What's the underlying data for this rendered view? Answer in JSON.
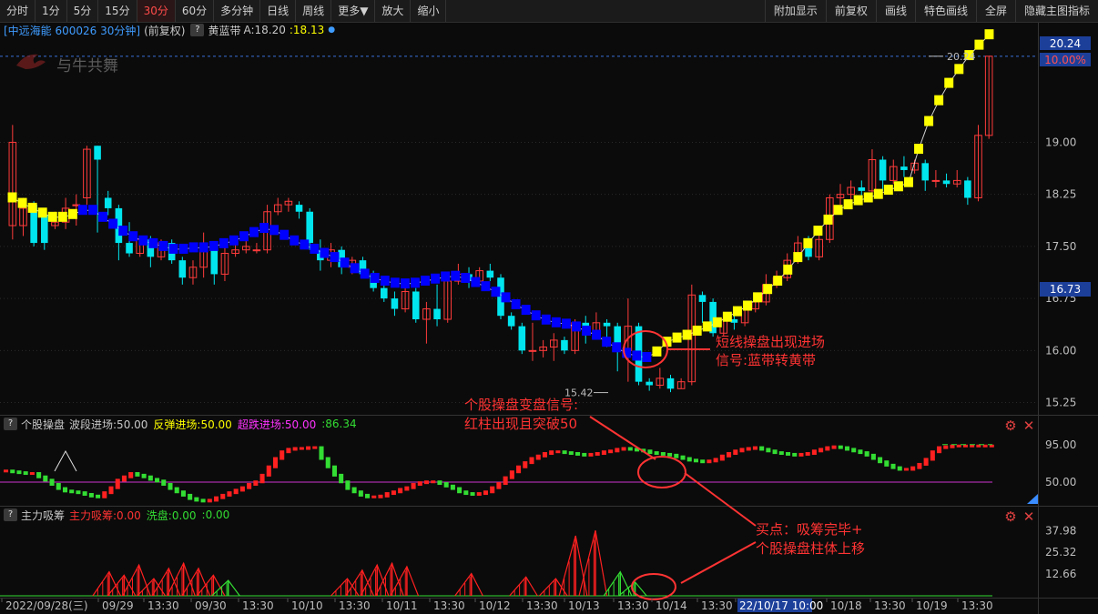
{
  "toolbar": {
    "left": [
      "分时",
      "1分",
      "5分",
      "15分",
      "30分",
      "60分",
      "多分钟",
      "日线",
      "周线",
      "更多▼",
      "放大",
      "缩小"
    ],
    "active": "30分",
    "right": [
      "附加显示",
      "前复权",
      "画线",
      "特色画线",
      "全屏",
      "隐藏主图指标"
    ]
  },
  "main_header": {
    "stock": "[中远海能 600026 30分钟]",
    "adjust": "(前复权)",
    "help": "?",
    "indicator_name": "黄蓝带",
    "a_label": "A:",
    "a_value": "18.20",
    "b_value": ":18.13",
    "watermark": "与牛共舞"
  },
  "price_axis": {
    "ticks": [
      "19.00",
      "18.25",
      "17.50",
      "16.75",
      "16.00",
      "15.25"
    ],
    "last_price": "20.24",
    "last_pct": "10.00%",
    "cursor_price": "16.73"
  },
  "annotations": {
    "high": "20.24",
    "low": "15.42",
    "main_note_1": "短线操盘出现进场",
    "main_note_2": "信号:蓝带转黄带",
    "mid_note_1": "个股操盘变盘信号:",
    "mid_note_2": "红柱出现且突破50",
    "bottom_note_1": "买点：吸筹完毕+",
    "bottom_note_2": "个股操盘柱体上移"
  },
  "panel2": {
    "help": "?",
    "name": "个股操盘",
    "l1": "波段进场:50.00",
    "l2": "反弹进场:50.00",
    "l3": "超跌进场:50.00",
    "l4": ":86.34",
    "ticks": [
      "95.00",
      "50.00"
    ],
    "gear": "gear-icon",
    "close": "close-icon"
  },
  "panel3": {
    "help": "?",
    "name": "主力吸筹",
    "l1": "主力吸筹:0.00",
    "l2": "洗盘:0.00",
    "l3": ":0.00",
    "ticks": [
      "37.98",
      "25.32",
      "12.66"
    ]
  },
  "time_axis": [
    "2022/09/28(三)",
    "09/29",
    "13:30",
    "09/30",
    "13:30",
    "10/10",
    "13:30",
    "10/11",
    "13:30",
    "10/12",
    "13:30",
    "10/13",
    "13:30",
    "10/14",
    "13:30",
    "22/10/17 10:00",
    "10/18",
    "13:30",
    "10/19",
    "13:30"
  ],
  "colors": {
    "up": "#ff3b3b",
    "down": "#00e5ee",
    "yellow_band": "#ffff00",
    "blue_band": "#0000ff",
    "osc_up": "#ff2020",
    "osc_down": "#33dd33",
    "accum_red": "#ff2020",
    "accum_green": "#33dd33",
    "ref_line": "#cc33cc",
    "annotation": "#ff3333"
  },
  "chart_data": [
    {
      "type": "candlestick",
      "title": "中远海能 600026 30分钟",
      "y_range": [
        15.1,
        20.5
      ],
      "y_ticks": [
        15.25,
        16.0,
        16.75,
        17.5,
        18.25,
        19.0
      ],
      "candles": [
        [
          17.8,
          19.0,
          19.25,
          17.6
        ],
        [
          17.8,
          18.05,
          18.2,
          17.65
        ],
        [
          18.1,
          17.55,
          18.15,
          17.5
        ],
        [
          17.95,
          17.55,
          18.05,
          17.45
        ],
        [
          17.8,
          17.85,
          18.0,
          17.75
        ],
        [
          17.85,
          18.05,
          18.2,
          17.75
        ],
        [
          18.1,
          18.1,
          18.25,
          17.8
        ],
        [
          18.2,
          18.9,
          18.95,
          18.1
        ],
        [
          18.95,
          18.75,
          18.95,
          17.7
        ],
        [
          18.2,
          18.05,
          18.3,
          17.95
        ],
        [
          18.05,
          17.55,
          18.1,
          17.3
        ],
        [
          17.55,
          17.4,
          17.85,
          17.35
        ],
        [
          17.4,
          17.6,
          17.65,
          17.35
        ],
        [
          17.6,
          17.35,
          17.65,
          17.2
        ],
        [
          17.35,
          17.55,
          17.6,
          17.3
        ],
        [
          17.55,
          17.3,
          17.6,
          17.25
        ],
        [
          17.3,
          17.05,
          17.35,
          16.95
        ],
        [
          17.05,
          17.2,
          17.3,
          16.95
        ],
        [
          17.2,
          17.55,
          17.7,
          17.05
        ],
        [
          17.5,
          17.1,
          17.55,
          16.95
        ],
        [
          17.1,
          17.4,
          17.5,
          17.0
        ],
        [
          17.4,
          17.45,
          17.6,
          17.35
        ],
        [
          17.45,
          17.5,
          17.65,
          17.4
        ],
        [
          17.45,
          17.45,
          17.55,
          17.4
        ],
        [
          17.45,
          18.0,
          18.1,
          17.4
        ],
        [
          18.0,
          18.1,
          18.2,
          17.95
        ],
        [
          18.1,
          18.15,
          18.2,
          18.0
        ],
        [
          18.1,
          18.0,
          18.15,
          17.9
        ],
        [
          18.0,
          17.55,
          18.05,
          17.45
        ],
        [
          17.45,
          17.3,
          17.6,
          17.15
        ],
        [
          17.3,
          17.45,
          17.55,
          17.2
        ],
        [
          17.45,
          17.2,
          17.5,
          17.1
        ],
        [
          17.2,
          17.3,
          17.35,
          17.1
        ],
        [
          17.3,
          17.1,
          17.35,
          17.05
        ],
        [
          17.1,
          16.9,
          17.15,
          16.85
        ],
        [
          16.9,
          16.75,
          16.95,
          16.7
        ],
        [
          16.75,
          16.6,
          16.85,
          16.5
        ],
        [
          16.6,
          16.85,
          16.95,
          16.55
        ],
        [
          16.85,
          16.45,
          16.9,
          16.4
        ],
        [
          16.45,
          16.6,
          16.7,
          16.1
        ],
        [
          16.6,
          16.45,
          16.95,
          16.35
        ],
        [
          16.45,
          17.0,
          17.1,
          16.4
        ],
        [
          17.0,
          17.1,
          17.25,
          16.95
        ],
        [
          17.1,
          17.0,
          17.2,
          16.9
        ],
        [
          17.0,
          17.15,
          17.2,
          16.95
        ],
        [
          17.15,
          17.05,
          17.25,
          17.0
        ],
        [
          17.05,
          16.5,
          17.1,
          16.45
        ],
        [
          16.5,
          16.35,
          16.55,
          16.3
        ],
        [
          16.35,
          16.0,
          16.4,
          15.95
        ],
        [
          16.0,
          16.0,
          16.4,
          15.85
        ],
        [
          16.0,
          16.05,
          16.15,
          15.9
        ],
        [
          16.05,
          16.15,
          16.25,
          15.85
        ],
        [
          16.15,
          16.0,
          16.2,
          15.95
        ],
        [
          16.0,
          16.4,
          16.45,
          15.95
        ],
        [
          16.4,
          16.25,
          16.5,
          16.1
        ],
        [
          16.25,
          16.4,
          16.55,
          16.2
        ],
        [
          16.4,
          16.35,
          16.45,
          16.05
        ],
        [
          16.35,
          16.0,
          16.4,
          15.7
        ],
        [
          16.0,
          16.35,
          16.75,
          15.55
        ],
        [
          16.35,
          15.55,
          16.4,
          15.5
        ],
        [
          15.55,
          15.5,
          15.6,
          15.42
        ],
        [
          15.5,
          15.6,
          15.75,
          15.45
        ],
        [
          15.6,
          15.45,
          15.65,
          15.4
        ],
        [
          15.45,
          15.55,
          15.6,
          15.45
        ],
        [
          15.55,
          16.8,
          16.95,
          15.5
        ],
        [
          16.8,
          16.7,
          16.85,
          16.4
        ],
        [
          16.7,
          16.25,
          16.75,
          16.2
        ],
        [
          16.25,
          16.45,
          16.5,
          16.2
        ],
        [
          16.45,
          16.4,
          16.5,
          16.3
        ],
        [
          16.4,
          16.6,
          16.65,
          16.35
        ],
        [
          16.6,
          16.7,
          16.75,
          16.55
        ],
        [
          16.7,
          16.95,
          17.1,
          16.65
        ],
        [
          16.95,
          17.05,
          17.15,
          16.9
        ],
        [
          17.05,
          17.3,
          17.4,
          17.0
        ],
        [
          17.3,
          17.55,
          17.65,
          17.25
        ],
        [
          17.55,
          17.35,
          17.65,
          17.3
        ],
        [
          17.35,
          17.6,
          17.7,
          17.3
        ],
        [
          17.6,
          18.2,
          18.25,
          17.55
        ],
        [
          18.2,
          18.25,
          18.4,
          18.1
        ],
        [
          18.25,
          18.35,
          18.45,
          18.15
        ],
        [
          18.35,
          18.3,
          18.45,
          18.2
        ],
        [
          18.3,
          18.75,
          18.9,
          18.25
        ],
        [
          18.75,
          18.45,
          18.8,
          18.3
        ],
        [
          18.45,
          18.65,
          18.75,
          18.4
        ],
        [
          18.65,
          18.6,
          18.8,
          18.5
        ],
        [
          18.6,
          18.7,
          18.75,
          18.55
        ],
        [
          18.7,
          18.45,
          18.75,
          18.3
        ],
        [
          18.45,
          18.45,
          18.6,
          18.35
        ],
        [
          18.45,
          18.4,
          18.55,
          18.35
        ],
        [
          18.4,
          18.45,
          18.6,
          18.35
        ],
        [
          18.45,
          18.2,
          18.5,
          18.1
        ],
        [
          18.2,
          19.1,
          19.25,
          18.15
        ],
        [
          19.1,
          20.24,
          20.24,
          19.05
        ]
      ],
      "band": [
        18.2,
        18.12,
        18.05,
        17.98,
        17.92,
        17.92,
        17.96,
        18.02,
        18.02,
        17.92,
        17.82,
        17.72,
        17.64,
        17.58,
        17.54,
        17.5,
        17.46,
        17.46,
        17.48,
        17.48,
        17.5,
        17.54,
        17.58,
        17.64,
        17.7,
        17.76,
        17.73,
        17.66,
        17.58,
        17.52,
        17.46,
        17.4,
        17.34,
        17.26,
        17.18,
        17.1,
        17.04,
        17.0,
        16.97,
        16.96,
        16.97,
        17.0,
        17.03,
        17.06,
        17.07,
        17.04,
        16.98,
        16.92,
        16.84,
        16.76,
        16.66,
        16.58,
        16.5,
        16.44,
        16.4,
        16.38,
        16.34,
        16.28,
        16.22,
        16.12,
        16.04,
        15.96,
        15.92,
        15.9,
        15.98,
        16.12,
        16.18,
        16.22,
        16.28,
        16.34,
        16.4,
        16.48,
        16.56,
        16.64,
        16.76,
        16.88,
        17.0,
        17.16,
        17.34,
        17.54,
        17.72,
        17.88,
        18.02,
        18.1,
        18.16,
        18.2,
        18.25,
        18.31,
        18.36,
        18.42,
        18.9,
        19.3,
        19.6,
        19.85,
        20.05,
        20.25,
        20.4,
        20.55
      ],
      "band_color_switch_index": 64,
      "high_label": 20.24,
      "low_label": 15.42
    },
    {
      "type": "bar",
      "title": "个股操盘",
      "reference_line": 50.0,
      "y_ticks": [
        50.0,
        95.0
      ],
      "y_range": [
        25,
        110
      ],
      "values": [
        65,
        64,
        63,
        62,
        62,
        58,
        54,
        49,
        44,
        41,
        40,
        39,
        37,
        35,
        34,
        39,
        45,
        54,
        58,
        62,
        60,
        58,
        55,
        53,
        49,
        44,
        40,
        36,
        32,
        30,
        29,
        30,
        33,
        36,
        39,
        42,
        45,
        49,
        52,
        60,
        70,
        80,
        88,
        91,
        92,
        92,
        93,
        93,
        80,
        70,
        60,
        52,
        44,
        40,
        36,
        34,
        34,
        35,
        38,
        40,
        43,
        45,
        49,
        51,
        52,
        52,
        50,
        47,
        44,
        40,
        38,
        37,
        38,
        40,
        45,
        50,
        57,
        64,
        70,
        75,
        80,
        83,
        86,
        88,
        88,
        87,
        86,
        85,
        84,
        85,
        86,
        88,
        89,
        91,
        92,
        91,
        90,
        89,
        87,
        86,
        85,
        84,
        82,
        80,
        78,
        77,
        76,
        77,
        79,
        83,
        86,
        89,
        91,
        92,
        93,
        91,
        89,
        87,
        86,
        85,
        84,
        85,
        86,
        89,
        91,
        93,
        94,
        93,
        91,
        89,
        87,
        84,
        80,
        76,
        72,
        69,
        67,
        67,
        69,
        73,
        79,
        88,
        93,
        94,
        95,
        95,
        95,
        95,
        95,
        95,
        95
      ],
      "colors": "uppercase_red_when_rising"
    },
    {
      "type": "bar",
      "title": "主力吸筹",
      "y_ticks": [
        12.66,
        25.32,
        37.98
      ],
      "y_range": [
        0,
        44
      ],
      "peaks": [
        [
          0.11,
          14
        ],
        [
          0.125,
          12
        ],
        [
          0.14,
          18
        ],
        [
          0.155,
          10
        ],
        [
          0.17,
          16
        ],
        [
          0.185,
          19
        ],
        [
          0.2,
          16
        ],
        [
          0.215,
          12
        ],
        [
          0.23,
          9
        ],
        [
          0.35,
          10
        ],
        [
          0.365,
          15
        ],
        [
          0.38,
          18
        ],
        [
          0.395,
          19
        ],
        [
          0.41,
          17
        ],
        [
          0.475,
          13
        ],
        [
          0.53,
          11
        ],
        [
          0.56,
          10
        ],
        [
          0.58,
          35
        ],
        [
          0.6,
          38
        ],
        [
          0.625,
          14
        ],
        [
          0.64,
          8
        ]
      ]
    }
  ]
}
